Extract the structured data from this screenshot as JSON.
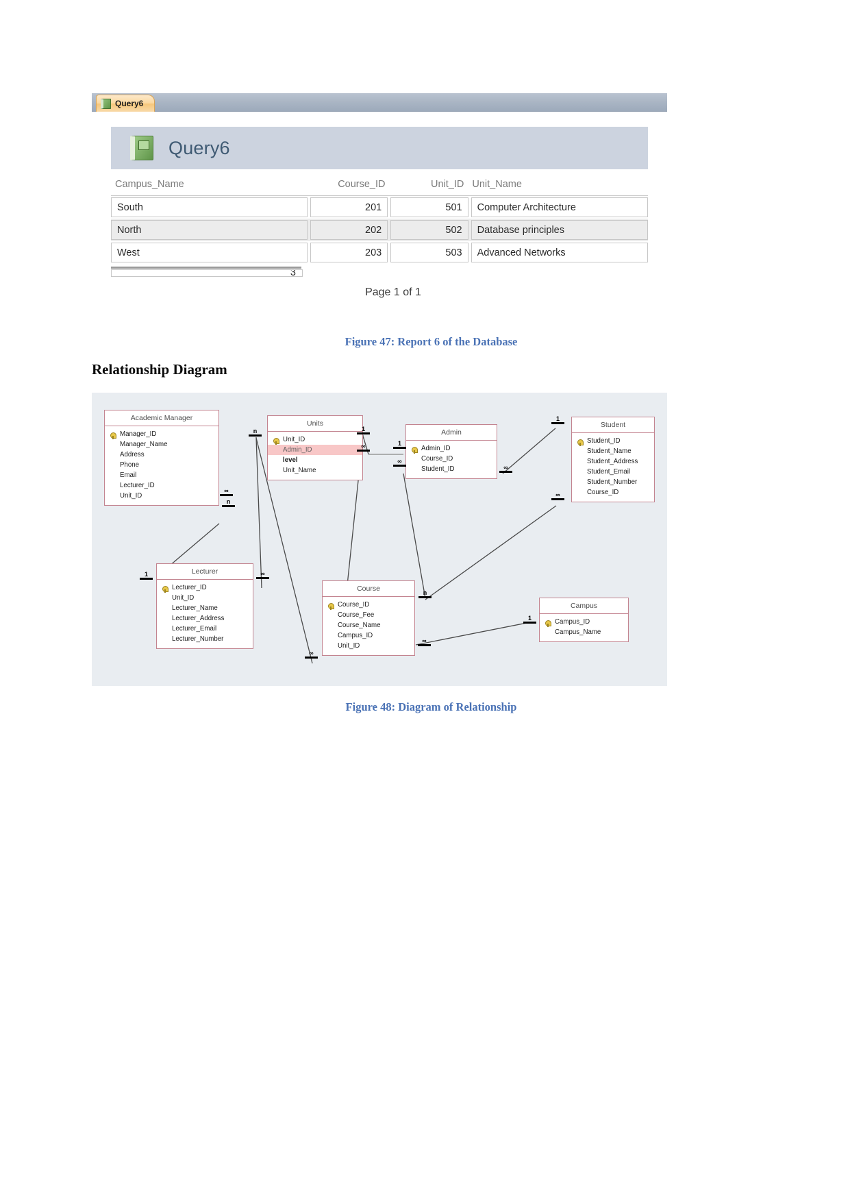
{
  "report": {
    "tab": {
      "label": "Query6",
      "icon": "report-icon"
    },
    "title": "Query6",
    "columns": [
      "Campus_Name",
      "Course_ID",
      "Unit_ID",
      "Unit_Name"
    ],
    "rows": [
      [
        "South",
        "201",
        "501",
        "Computer Architecture"
      ],
      [
        "North",
        "202",
        "502",
        "Database principles"
      ],
      [
        "West",
        "203",
        "503",
        "Advanced Networks"
      ]
    ],
    "partial_row_value": "3",
    "page_footer": "Page 1 of 1"
  },
  "document": {
    "figure_47_caption": "Figure 47: Report 6 of the Database",
    "section_heading": "Relationship Diagram",
    "figure_48_caption": "Figure 48: Diagram of Relationship"
  },
  "diagram": {
    "entities": [
      {
        "name": "Academic Manager",
        "fields": [
          {
            "label": "Manager_ID",
            "pk": true
          },
          {
            "label": "Manager_Name",
            "pk": false
          },
          {
            "label": "Address",
            "pk": false
          },
          {
            "label": "Phone",
            "pk": false
          },
          {
            "label": "Email",
            "pk": false
          },
          {
            "label": "Lecturer_ID",
            "pk": false
          },
          {
            "label": "Unit_ID",
            "pk": false
          }
        ]
      },
      {
        "name": "Units",
        "fields": [
          {
            "label": "Unit_ID",
            "pk": true
          },
          {
            "label": "Admin_ID",
            "pk": false,
            "selected": true
          },
          {
            "label": "level",
            "pk": false,
            "bold": true
          },
          {
            "label": "Unit_Name",
            "pk": false
          }
        ]
      },
      {
        "name": "Admin",
        "fields": [
          {
            "label": "Admin_ID",
            "pk": true
          },
          {
            "label": "Course_ID",
            "pk": false
          },
          {
            "label": "Student_ID",
            "pk": false
          }
        ]
      },
      {
        "name": "Student",
        "fields": [
          {
            "label": "Student_ID",
            "pk": true
          },
          {
            "label": "Student_Name",
            "pk": false
          },
          {
            "label": "Student_Address",
            "pk": false
          },
          {
            "label": "Student_Email",
            "pk": false
          },
          {
            "label": "Student_Number",
            "pk": false
          },
          {
            "label": "Course_ID",
            "pk": false
          }
        ]
      },
      {
        "name": "Lecturer",
        "fields": [
          {
            "label": "Lecturer_ID",
            "pk": true
          },
          {
            "label": "Unit_ID",
            "pk": false
          },
          {
            "label": "Lecturer_Name",
            "pk": false
          },
          {
            "label": "Lecturer_Address",
            "pk": false
          },
          {
            "label": "Lecturer_Email",
            "pk": false
          },
          {
            "label": "Lecturer_Number",
            "pk": false
          }
        ]
      },
      {
        "name": "Course",
        "fields": [
          {
            "label": "Course_ID",
            "pk": true
          },
          {
            "label": "Course_Fee",
            "pk": false
          },
          {
            "label": "Course_Name",
            "pk": false
          },
          {
            "label": "Campus_ID",
            "pk": false
          },
          {
            "label": "Unit_ID",
            "pk": false
          }
        ]
      },
      {
        "name": "Campus",
        "fields": [
          {
            "label": "Campus_ID",
            "pk": true
          },
          {
            "label": "Campus_Name",
            "pk": false
          }
        ]
      }
    ],
    "cardinality_labels": {
      "n_units_left": "n",
      "one_units_right": "1",
      "infinity_units_right": "∞",
      "one_admin_left": "1",
      "infinity_admin_left": "∞",
      "one_student": "1",
      "infinity_student_upper": "∞",
      "infinity_student_lower": "∞",
      "infinity_manager": "∞",
      "n_manager": "n",
      "one_lecturer": "1",
      "infinity_lecturer_right": "∞",
      "n_course_top": "n",
      "infinity_course_left": "∞",
      "infinity_course_right": "∞",
      "one_campus": "1"
    }
  },
  "colors": {
    "caption_blue": "#4a72b5",
    "entity_border": "#c38490",
    "selected_field": "#f8c7c7",
    "diagram_bg": "#e9edf1",
    "tab_orange": "#f6c77d"
  }
}
